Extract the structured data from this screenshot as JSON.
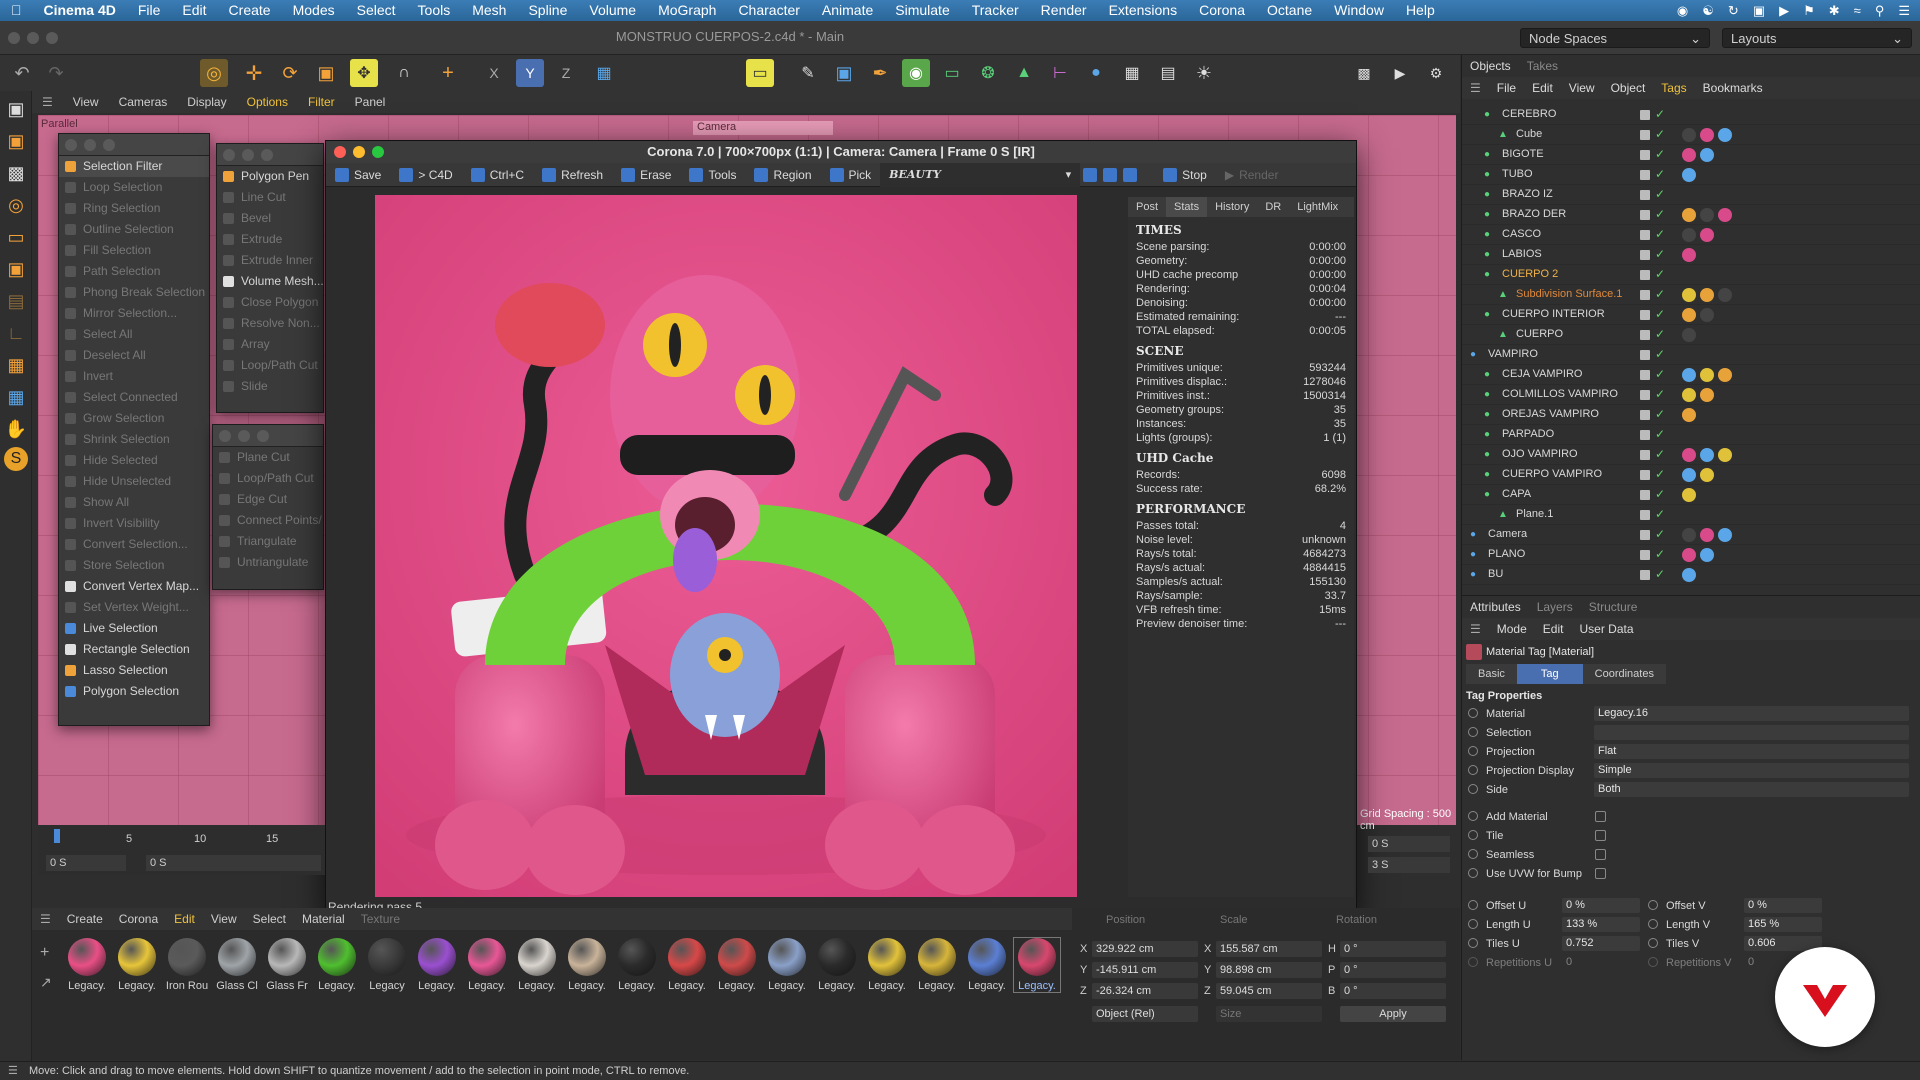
{
  "menubar": {
    "app": "Cinema 4D",
    "items": [
      "File",
      "Edit",
      "Create",
      "Modes",
      "Select",
      "Tools",
      "Mesh",
      "Spline",
      "Volume",
      "MoGraph",
      "Character",
      "Animate",
      "Simulate",
      "Tracker",
      "Render",
      "Extensions",
      "Corona",
      "Octane",
      "Window",
      "Help"
    ]
  },
  "window": {
    "title": "MONSTRUO CUERPOS-2.c4d * - Main",
    "node_spaces": "Node Spaces",
    "layouts": "Layouts"
  },
  "viewport_menu": [
    "View",
    "Cameras",
    "Display",
    "Options",
    "Filter",
    "Panel"
  ],
  "viewport": {
    "projection": "Parallel",
    "camera_label": "Camera",
    "grid_spacing": "Grid Spacing : 500 cm"
  },
  "selection_menu": {
    "items": [
      {
        "label": "Selection Filter",
        "enabled": true
      },
      {
        "label": "Loop Selection",
        "enabled": false
      },
      {
        "label": "Ring Selection",
        "enabled": false
      },
      {
        "label": "Outline Selection",
        "enabled": false
      },
      {
        "label": "Fill Selection",
        "enabled": false
      },
      {
        "label": "Path Selection",
        "enabled": false
      },
      {
        "label": "Phong Break Selection",
        "enabled": false
      },
      {
        "label": "Mirror Selection...",
        "enabled": false
      },
      {
        "label": "Select All",
        "enabled": false
      },
      {
        "label": "Deselect All",
        "enabled": false
      },
      {
        "label": "Invert",
        "enabled": false
      },
      {
        "label": "Select Connected",
        "enabled": false
      },
      {
        "label": "Grow Selection",
        "enabled": false
      },
      {
        "label": "Shrink Selection",
        "enabled": false
      },
      {
        "label": "Hide Selected",
        "enabled": false
      },
      {
        "label": "Hide Unselected",
        "enabled": false
      },
      {
        "label": "Show All",
        "enabled": false
      },
      {
        "label": "Invert Visibility",
        "enabled": false
      },
      {
        "label": "Convert Selection...",
        "enabled": false
      },
      {
        "label": "Store Selection",
        "enabled": false
      },
      {
        "label": "Convert Vertex Map...",
        "enabled": true
      },
      {
        "label": "Set Vertex Weight...",
        "enabled": false
      },
      {
        "label": "Live Selection",
        "enabled": true
      },
      {
        "label": "Rectangle Selection",
        "enabled": true
      },
      {
        "label": "Lasso Selection",
        "enabled": true
      },
      {
        "label": "Polygon Selection",
        "enabled": true
      }
    ]
  },
  "mesh_menu": {
    "items": [
      {
        "label": "Polygon Pen",
        "enabled": true
      },
      {
        "label": "Line Cut",
        "enabled": false
      },
      {
        "label": "Bevel",
        "enabled": false
      },
      {
        "label": "Extrude",
        "enabled": false
      },
      {
        "label": "Extrude Inner",
        "enabled": false
      },
      {
        "label": "Volume Mesh...",
        "enabled": true
      },
      {
        "label": "Close Polygon",
        "enabled": false
      },
      {
        "label": "Resolve Non...",
        "enabled": false
      },
      {
        "label": "Array",
        "enabled": false
      },
      {
        "label": "Loop/Path Cut",
        "enabled": false
      },
      {
        "label": "Slide",
        "enabled": false
      }
    ]
  },
  "cut_menu": {
    "items": [
      {
        "label": "Plane Cut",
        "enabled": false
      },
      {
        "label": "Loop/Path Cut",
        "enabled": false
      },
      {
        "label": "Edge Cut",
        "enabled": false
      },
      {
        "label": "Connect Points/",
        "enabled": false
      },
      {
        "label": "Triangulate",
        "enabled": false
      },
      {
        "label": "Untriangulate",
        "enabled": false
      }
    ]
  },
  "render": {
    "title": "Corona 7.0 | 700×700px (1:1) | Camera: Camera | Frame 0 S [IR]",
    "toolbar": [
      "Save",
      "> C4D",
      "Ctrl+C",
      "Refresh",
      "Erase",
      "Tools",
      "Region",
      "Pick"
    ],
    "pass": "BEAUTY",
    "stop": "Stop",
    "render_btn": "Render",
    "tabs": [
      "Post",
      "Stats",
      "History",
      "DR",
      "LightMix"
    ],
    "status": "Rendering pass 5",
    "stats": {
      "times_title": "TIMES",
      "times": [
        [
          "Scene parsing:",
          "0:00:00"
        ],
        [
          "Geometry:",
          "0:00:00"
        ],
        [
          "UHD cache precomp",
          "0:00:00"
        ],
        [
          "Rendering:",
          "0:00:04"
        ],
        [
          "Denoising:",
          "0:00:00"
        ],
        [
          "Estimated remaining:",
          "---"
        ],
        [
          "TOTAL elapsed:",
          "0:00:05"
        ]
      ],
      "scene_title": "SCENE",
      "scene": [
        [
          "Primitives unique:",
          "593244"
        ],
        [
          "Primitives displac.:",
          "1278046"
        ],
        [
          "Primitives inst.:",
          "1500314"
        ],
        [
          "Geometry groups:",
          "35"
        ],
        [
          "Instances:",
          "35"
        ],
        [
          "Lights (groups):",
          "1 (1)"
        ]
      ],
      "uhd_title": "UHD Cache",
      "uhd": [
        [
          "Records:",
          "6098"
        ],
        [
          "Success rate:",
          "68.2%"
        ]
      ],
      "perf_title": "PERFORMANCE",
      "perf": [
        [
          "Passes total:",
          "4"
        ],
        [
          "Noise level:",
          "unknown"
        ],
        [
          "Rays/s total:",
          "4684273"
        ],
        [
          "Rays/s actual:",
          "4884415"
        ],
        [
          "Samples/s actual:",
          "155130"
        ],
        [
          "Rays/sample:",
          "33.7"
        ],
        [
          "VFB refresh time:",
          "15ms"
        ],
        [
          "Preview denoiser time:",
          "---"
        ]
      ]
    }
  },
  "objects": {
    "tabs": [
      "Objects",
      "Takes"
    ],
    "menu": [
      "File",
      "Edit",
      "View",
      "Object",
      "Tags",
      "Bookmarks"
    ],
    "rows": [
      {
        "name": "CEREBRO",
        "indent": 1,
        "color": "#d8d8d8"
      },
      {
        "name": "Cube",
        "indent": 2,
        "color": "#d8d8d8"
      },
      {
        "name": "BIGOTE",
        "indent": 1,
        "color": "#d8d8d8"
      },
      {
        "name": "TUBO",
        "indent": 1,
        "color": "#d8d8d8"
      },
      {
        "name": "BRAZO IZ",
        "indent": 1,
        "color": "#d8d8d8"
      },
      {
        "name": "BRAZO DER",
        "indent": 1,
        "color": "#d8d8d8"
      },
      {
        "name": "CASCO",
        "indent": 1,
        "color": "#d8d8d8"
      },
      {
        "name": "LABIOS",
        "indent": 1,
        "color": "#d8d8d8"
      },
      {
        "name": "CUERPO 2",
        "indent": 1,
        "color": "#f0b24a"
      },
      {
        "name": "Subdivision Surface.1",
        "indent": 2,
        "color": "#e0883a"
      },
      {
        "name": "CUERPO INTERIOR",
        "indent": 1,
        "color": "#d8d8d8"
      },
      {
        "name": "CUERPO",
        "indent": 2,
        "color": "#d8d8d8"
      },
      {
        "name": "VAMPIRO",
        "indent": 0,
        "color": "#d8d8d8"
      },
      {
        "name": "CEJA VAMPIRO",
        "indent": 1,
        "color": "#d8d8d8"
      },
      {
        "name": "COLMILLOS VAMPIRO",
        "indent": 1,
        "color": "#d8d8d8"
      },
      {
        "name": "OREJAS VAMPIRO",
        "indent": 1,
        "color": "#d8d8d8"
      },
      {
        "name": "PARPADO",
        "indent": 1,
        "color": "#d8d8d8"
      },
      {
        "name": "OJO VAMPIRO",
        "indent": 1,
        "color": "#d8d8d8"
      },
      {
        "name": "CUERPO VAMPIRO",
        "indent": 1,
        "color": "#d8d8d8"
      },
      {
        "name": "CAPA",
        "indent": 1,
        "color": "#d8d8d8"
      },
      {
        "name": "Plane.1",
        "indent": 2,
        "color": "#d8d8d8"
      },
      {
        "name": "Camera",
        "indent": 0,
        "color": "#d8d8d8"
      },
      {
        "name": "PLANO",
        "indent": 0,
        "color": "#d8d8d8"
      },
      {
        "name": "BU",
        "indent": 0,
        "color": "#d8d8d8"
      }
    ]
  },
  "attributes": {
    "tabs": [
      "Attributes",
      "Layers",
      "Structure"
    ],
    "menu": [
      "Mode",
      "Edit",
      "User Data"
    ],
    "object_title": "Material Tag [Material]",
    "subtabs": [
      "Basic",
      "Tag",
      "Coordinates"
    ],
    "section": "Tag Properties",
    "props": [
      {
        "label": "Material",
        "value": "Legacy.16"
      },
      {
        "label": "Selection",
        "value": ""
      },
      {
        "label": "Projection",
        "value": "Flat"
      },
      {
        "label": "Projection Display",
        "value": "Simple"
      },
      {
        "label": "Side",
        "value": "Both"
      }
    ],
    "checks": [
      "Add Material",
      "Tile",
      "Seamless",
      "Use UVW for Bump"
    ],
    "offset_u": {
      "label": "Offset U",
      "value": "0 %"
    },
    "offset_v": {
      "label": "Offset V",
      "value": "0 %"
    },
    "length_u": {
      "label": "Length U",
      "value": "133 %"
    },
    "length_v": {
      "label": "Length V",
      "value": "165 %"
    },
    "tiles_u": {
      "label": "Tiles U",
      "value": "0.752"
    },
    "tiles_v": {
      "label": "Tiles V",
      "value": "0.606"
    },
    "rep_u": {
      "label": "Repetitions U",
      "value": "0"
    },
    "rep_v": {
      "label": "Repetitions V",
      "value": "0"
    }
  },
  "timeline": {
    "ticks": [
      "0",
      "5",
      "10",
      "15"
    ],
    "start": "0 S",
    "current": "0 S",
    "end_a": "0 S",
    "end_b": "3 S"
  },
  "material_menu": [
    "Create",
    "Corona",
    "Edit",
    "View",
    "Select",
    "Material",
    "Texture"
  ],
  "materials": [
    {
      "label": "Legacy.",
      "color": "#e94f86"
    },
    {
      "label": "Legacy.",
      "color": "#e7c53a"
    },
    {
      "label": "Iron Rou",
      "color": "#5a5a5a"
    },
    {
      "label": "Glass Cl",
      "color": "#9fa4a8"
    },
    {
      "label": "Glass Fr",
      "color": "#b8b8b8"
    },
    {
      "label": "Legacy.",
      "color": "#4fbf2f"
    },
    {
      "label": "Legacy",
      "color": "#3b3b3b"
    },
    {
      "label": "Legacy.",
      "color": "#9a4fd0"
    },
    {
      "label": "Legacy.",
      "color": "#e85796"
    },
    {
      "label": "Legacy.",
      "color": "#d9d4ce"
    },
    {
      "label": "Legacy.",
      "color": "#c9b39a"
    },
    {
      "label": "Legacy.",
      "color": "#2b2b2b"
    },
    {
      "label": "Legacy.",
      "color": "#d84848"
    },
    {
      "label": "Legacy.",
      "color": "#cf4a4a"
    },
    {
      "label": "Legacy.",
      "color": "#8aa0c8"
    },
    {
      "label": "Legacy.",
      "color": "#2a2a2a"
    },
    {
      "label": "Legacy.",
      "color": "#e2c23a"
    },
    {
      "label": "Legacy.",
      "color": "#d7b53a"
    },
    {
      "label": "Legacy.",
      "color": "#5b7fd4"
    },
    {
      "label": "Legacy.",
      "color": "#d8476e"
    }
  ],
  "coords": {
    "headers": [
      "Position",
      "Scale",
      "Rotation"
    ],
    "x": {
      "pos": "329.922 cm",
      "scale": "155.587 cm",
      "rot": "0 °"
    },
    "y": {
      "pos": "-145.911 cm",
      "scale": "98.898 cm",
      "rot": "0 °"
    },
    "z": {
      "pos": "-26.324 cm",
      "scale": "59.045 cm",
      "rot": "0 °"
    },
    "mode": "Object (Rel)",
    "size": "Size",
    "apply": "Apply"
  },
  "statusbar": "Move: Click and drag to move elements. Hold down SHIFT to quantize movement / add to the selection in point mode, CTRL to remove."
}
